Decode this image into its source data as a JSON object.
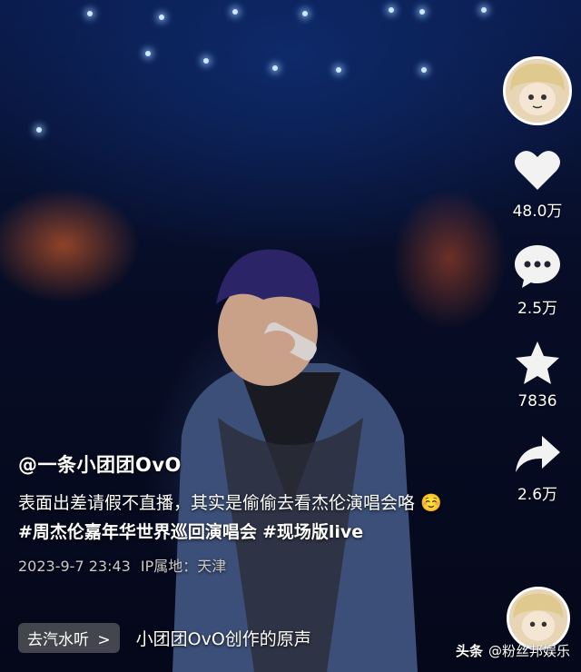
{
  "post": {
    "author": "@一条小团团OvO",
    "description": "表面出差请假不直播，其实是偷偷去看杰伦演唱会咯",
    "emoji": "☺️",
    "hashtag_1": "#周杰伦嘉年华世界巡回演唱会",
    "hashtag_2": "#现场版live",
    "date": "2023-9-7 23:43",
    "ip_label": "IP属地：天津"
  },
  "music": {
    "button_label": "去汽水听",
    "button_chevron": ">",
    "title": "小团团OvO创作的原声"
  },
  "actions": {
    "likes": "48.0万",
    "comments": "2.5万",
    "favorites": "7836",
    "shares": "2.6万"
  },
  "icons": {
    "like": "heart-icon",
    "comment": "comment-bubble-icon",
    "favorite": "star-icon",
    "share": "share-arrow-icon"
  },
  "watermark": {
    "brand": "头条",
    "account": "@粉丝邦娱乐"
  }
}
